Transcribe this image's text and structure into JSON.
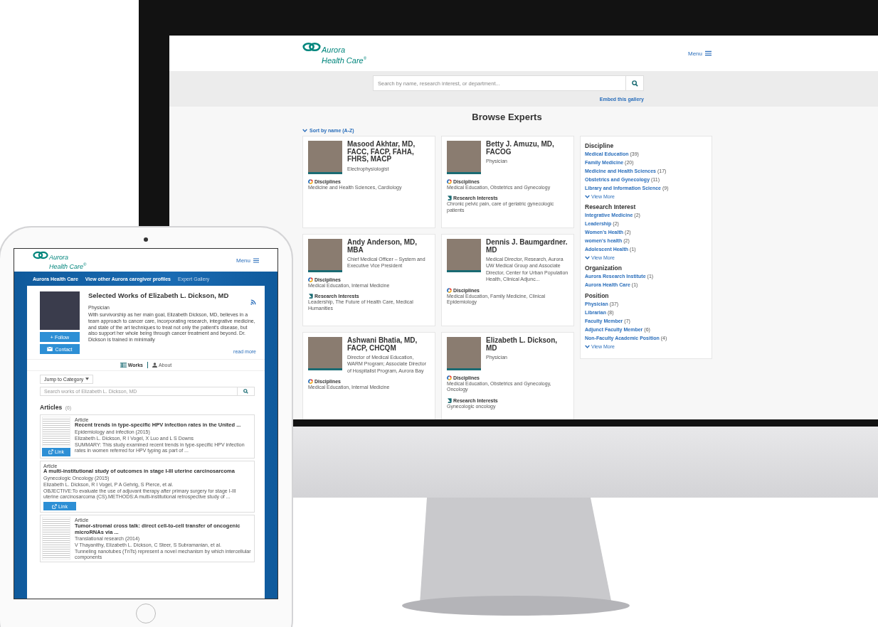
{
  "desktop": {
    "logo": {
      "line1": "Aurora",
      "line2": "Health Care",
      "mark": "®"
    },
    "menu": "Menu",
    "search": {
      "placeholder": "Search by name, research interest, or department...",
      "embed_link": "Embed this gallery"
    },
    "heading": "Browse Experts",
    "sort": "Sort by name (A-Z)",
    "experts": [
      {
        "name": "Masood Akhtar, MD, FACC, FACP, FAHA, FHRS, MACP",
        "title": "Electrophysiologist",
        "sections": [
          {
            "kind": "disciplines",
            "label": "Disciplines",
            "text": "Medicine and Health Sciences, Cardiology"
          }
        ]
      },
      {
        "name": "Betty J. Amuzu, MD, FACOG",
        "title": "Physician",
        "sections": [
          {
            "kind": "disciplines",
            "label": "Disciplines",
            "text": "Medical Education, Obstetrics and Gynecology"
          },
          {
            "kind": "research",
            "label": "Research Interests",
            "text": "Chronic pelvic pain, care of geriatric gynecologic patients"
          }
        ]
      },
      {
        "name": "Andy Anderson, MD, MBA",
        "title": "Chief Medical Officer – System and Executive Vice President",
        "sections": [
          {
            "kind": "disciplines",
            "label": "Disciplines",
            "text": "Medical Education, Internal Medicine"
          },
          {
            "kind": "research",
            "label": "Research Interests",
            "text": "Leadership, The Future of Health Care, Medical Humanities"
          }
        ]
      },
      {
        "name": "Dennis J. Baumgardner. MD",
        "title": "Medical Director, Research, Aurora UW Medical Group and Associate Director, Center for Urban Population Health, Clinical Adjunc...",
        "sections": [
          {
            "kind": "disciplines",
            "label": "Disciplines",
            "text": "Medical Education, Family Medicine, Clinical Epidemiology"
          }
        ]
      },
      {
        "name": "Ashwani Bhatia, MD, FACP, CHCQM",
        "title": "Director of Medical Education, WARM Program; Associate Director of Hospitalist Program, Aurora Bay",
        "sections": [
          {
            "kind": "disciplines",
            "label": "Disciplines",
            "text": "Medical Education, Internal Medicine"
          }
        ]
      },
      {
        "name": "Elizabeth L. Dickson, MD",
        "title": "Physician",
        "sections": [
          {
            "kind": "disciplines",
            "label": "Disciplines",
            "text": "Medical Education, Obstetrics and Gynecology, Oncology"
          },
          {
            "kind": "research",
            "label": "Research Interests",
            "text": "Gynecologic oncology"
          }
        ]
      }
    ],
    "facets": [
      {
        "title": "Discipline",
        "items": [
          {
            "label": "Medical Education",
            "count": "(39)"
          },
          {
            "label": "Family Medicine",
            "count": "(20)"
          },
          {
            "label": "Medicine and Health Sciences",
            "count": "(17)"
          },
          {
            "label": "Obstetrics and Gynecology",
            "count": "(11)"
          },
          {
            "label": "Library and Information Science",
            "count": "(9)"
          }
        ],
        "view_more": "View More"
      },
      {
        "title": "Research Interest",
        "items": [
          {
            "label": "Integrative Medicine",
            "count": "(2)"
          },
          {
            "label": "Leadership",
            "count": "(2)"
          },
          {
            "label": "Women's Health",
            "count": "(2)"
          },
          {
            "label": "women's health",
            "count": "(2)"
          },
          {
            "label": "Adolescent Health",
            "count": "(1)"
          }
        ],
        "view_more": "View More"
      },
      {
        "title": "Organization",
        "items": [
          {
            "label": "Aurora Research Institute",
            "count": "(1)"
          },
          {
            "label": "Aurora Health Care",
            "count": "(1)"
          }
        ]
      },
      {
        "title": "Position",
        "items": [
          {
            "label": "Physician",
            "count": "(37)"
          },
          {
            "label": "Librarian",
            "count": "(8)"
          },
          {
            "label": "Faculty Member",
            "count": "(7)"
          },
          {
            "label": "Adjunct Faculty Member",
            "count": "(6)"
          },
          {
            "label": "Non-Faculty Academic Position",
            "count": "(4)"
          }
        ],
        "view_more": "View More"
      }
    ]
  },
  "tablet": {
    "logo": {
      "line1": "Aurora",
      "line2": "Health Care",
      "mark": "®"
    },
    "menu": "Menu",
    "nav": [
      {
        "label": "Aurora Health Care",
        "selected": false
      },
      {
        "label": "View other Aurora caregiver profiles",
        "selected": false
      },
      {
        "label": "Expert Gallery",
        "selected": true
      }
    ],
    "profile": {
      "title": "Selected Works of Elizabeth L. Dickson, MD",
      "role": "Physician",
      "bio": "With survivorship as her main goal, Elizabeth Dickson, MD, believes in a team approach to cancer care, incorporating research, integrative medicine, and state of the art techniques to treat not only the patient's disease, but also support her whole being through cancer treatment and beyond. Dr. Dickson is trained in minimally",
      "read_more": "read more",
      "follow": "+ Follow",
      "contact": "Contact"
    },
    "tabs": [
      {
        "label": "Works",
        "kind": "works",
        "selected": true
      },
      {
        "label": "About",
        "kind": "about",
        "selected": false
      }
    ],
    "jump": "Jump to Category",
    "search": {
      "placeholder": "Search works of Elizabeth L. Dickson, MD"
    },
    "articles_heading": "Articles",
    "articles_count": "(6)",
    "articles": [
      {
        "has_thumbnail": true,
        "type": "Article",
        "title": "Recent trends in type-specific HPV infection rates in the United ...",
        "journal": "Epidemiology and infection (2015)",
        "authors": "Elizabeth L. Dickson, R I Vogel, X Luo and L S Downs",
        "summary": "SUMMARY: This study examined recent trends in type-specific HPV infection rates in women referred for HPV typing as part of ...",
        "link": "Link"
      },
      {
        "has_thumbnail": false,
        "type": "Article",
        "title": "A multi-institutional study of outcomes in stage I-III uterine carcinosarcoma",
        "journal": "Gynecologic Oncology (2015)",
        "authors": "Elizabeth L. Dickson, R I Vogel, P A Gehrig, S Pierce, et al.",
        "summary": "OBJECTIVE:To evaluate the use of adjuvant therapy after primary surgery for stage I-III uterine carcinosarcoma (CS).METHODS:A multi-institutional retrospective study of ...",
        "link": "Link"
      },
      {
        "has_thumbnail": true,
        "type": "Article",
        "title": "Tumor-stromal cross talk: direct cell-to-cell transfer of oncogenic microRNAs via ...",
        "journal": "Translational research (2014)",
        "authors": "V Thayanithy, Elizabeth L. Dickson, C Steer, S Subramanian, et al.",
        "summary": "Tunneling nanotubes (TnTs) represent a novel mechanism by which intercellular components"
      }
    ]
  }
}
